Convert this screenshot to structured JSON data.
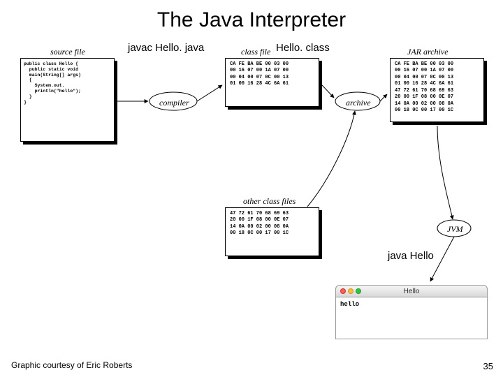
{
  "title": "The Java Interpreter",
  "labels": {
    "source": "source file",
    "class": "class file",
    "other": "other class files",
    "jar": "JAR archive",
    "compiler": "compiler",
    "archive": "archive",
    "jvm": "JVM"
  },
  "commands": {
    "javac": "javac Hello. java",
    "classname": "Hello. class",
    "run": "java Hello"
  },
  "source_code": "public class Hello {\n  public static void\n  main(String[] args)\n  {\n    System.out.\n    println(\"hello\");\n  }\n}",
  "hex": {
    "class": "CA FE BA BE 00 03 00\n00 16 07 00 1A 07 00\n00 04 00 07 0C 00 13\n01 00 16 28 4C 6A 61",
    "other": "47 72 61 70 68 69 63\n20 00 1F 08 00 0E 07\n14 0A 00 02 00 08 0A\n00 18 0C 00 17 00 1C",
    "jar": "CA FE BA BE 00 03 00\n00 16 07 00 1A 07 00\n00 04 00 07 0C 00 13\n01 00 16 28 4C 6A 61\n47 72 61 70 68 69 63\n20 00 1F 08 00 0E 07\n14 0A 00 02 00 08 0A\n00 18 0C 00 17 00 1C"
  },
  "terminal": {
    "title": "Hello",
    "output": "hello"
  },
  "credit": "Graphic courtesy of Eric Roberts",
  "slide_number": "35"
}
